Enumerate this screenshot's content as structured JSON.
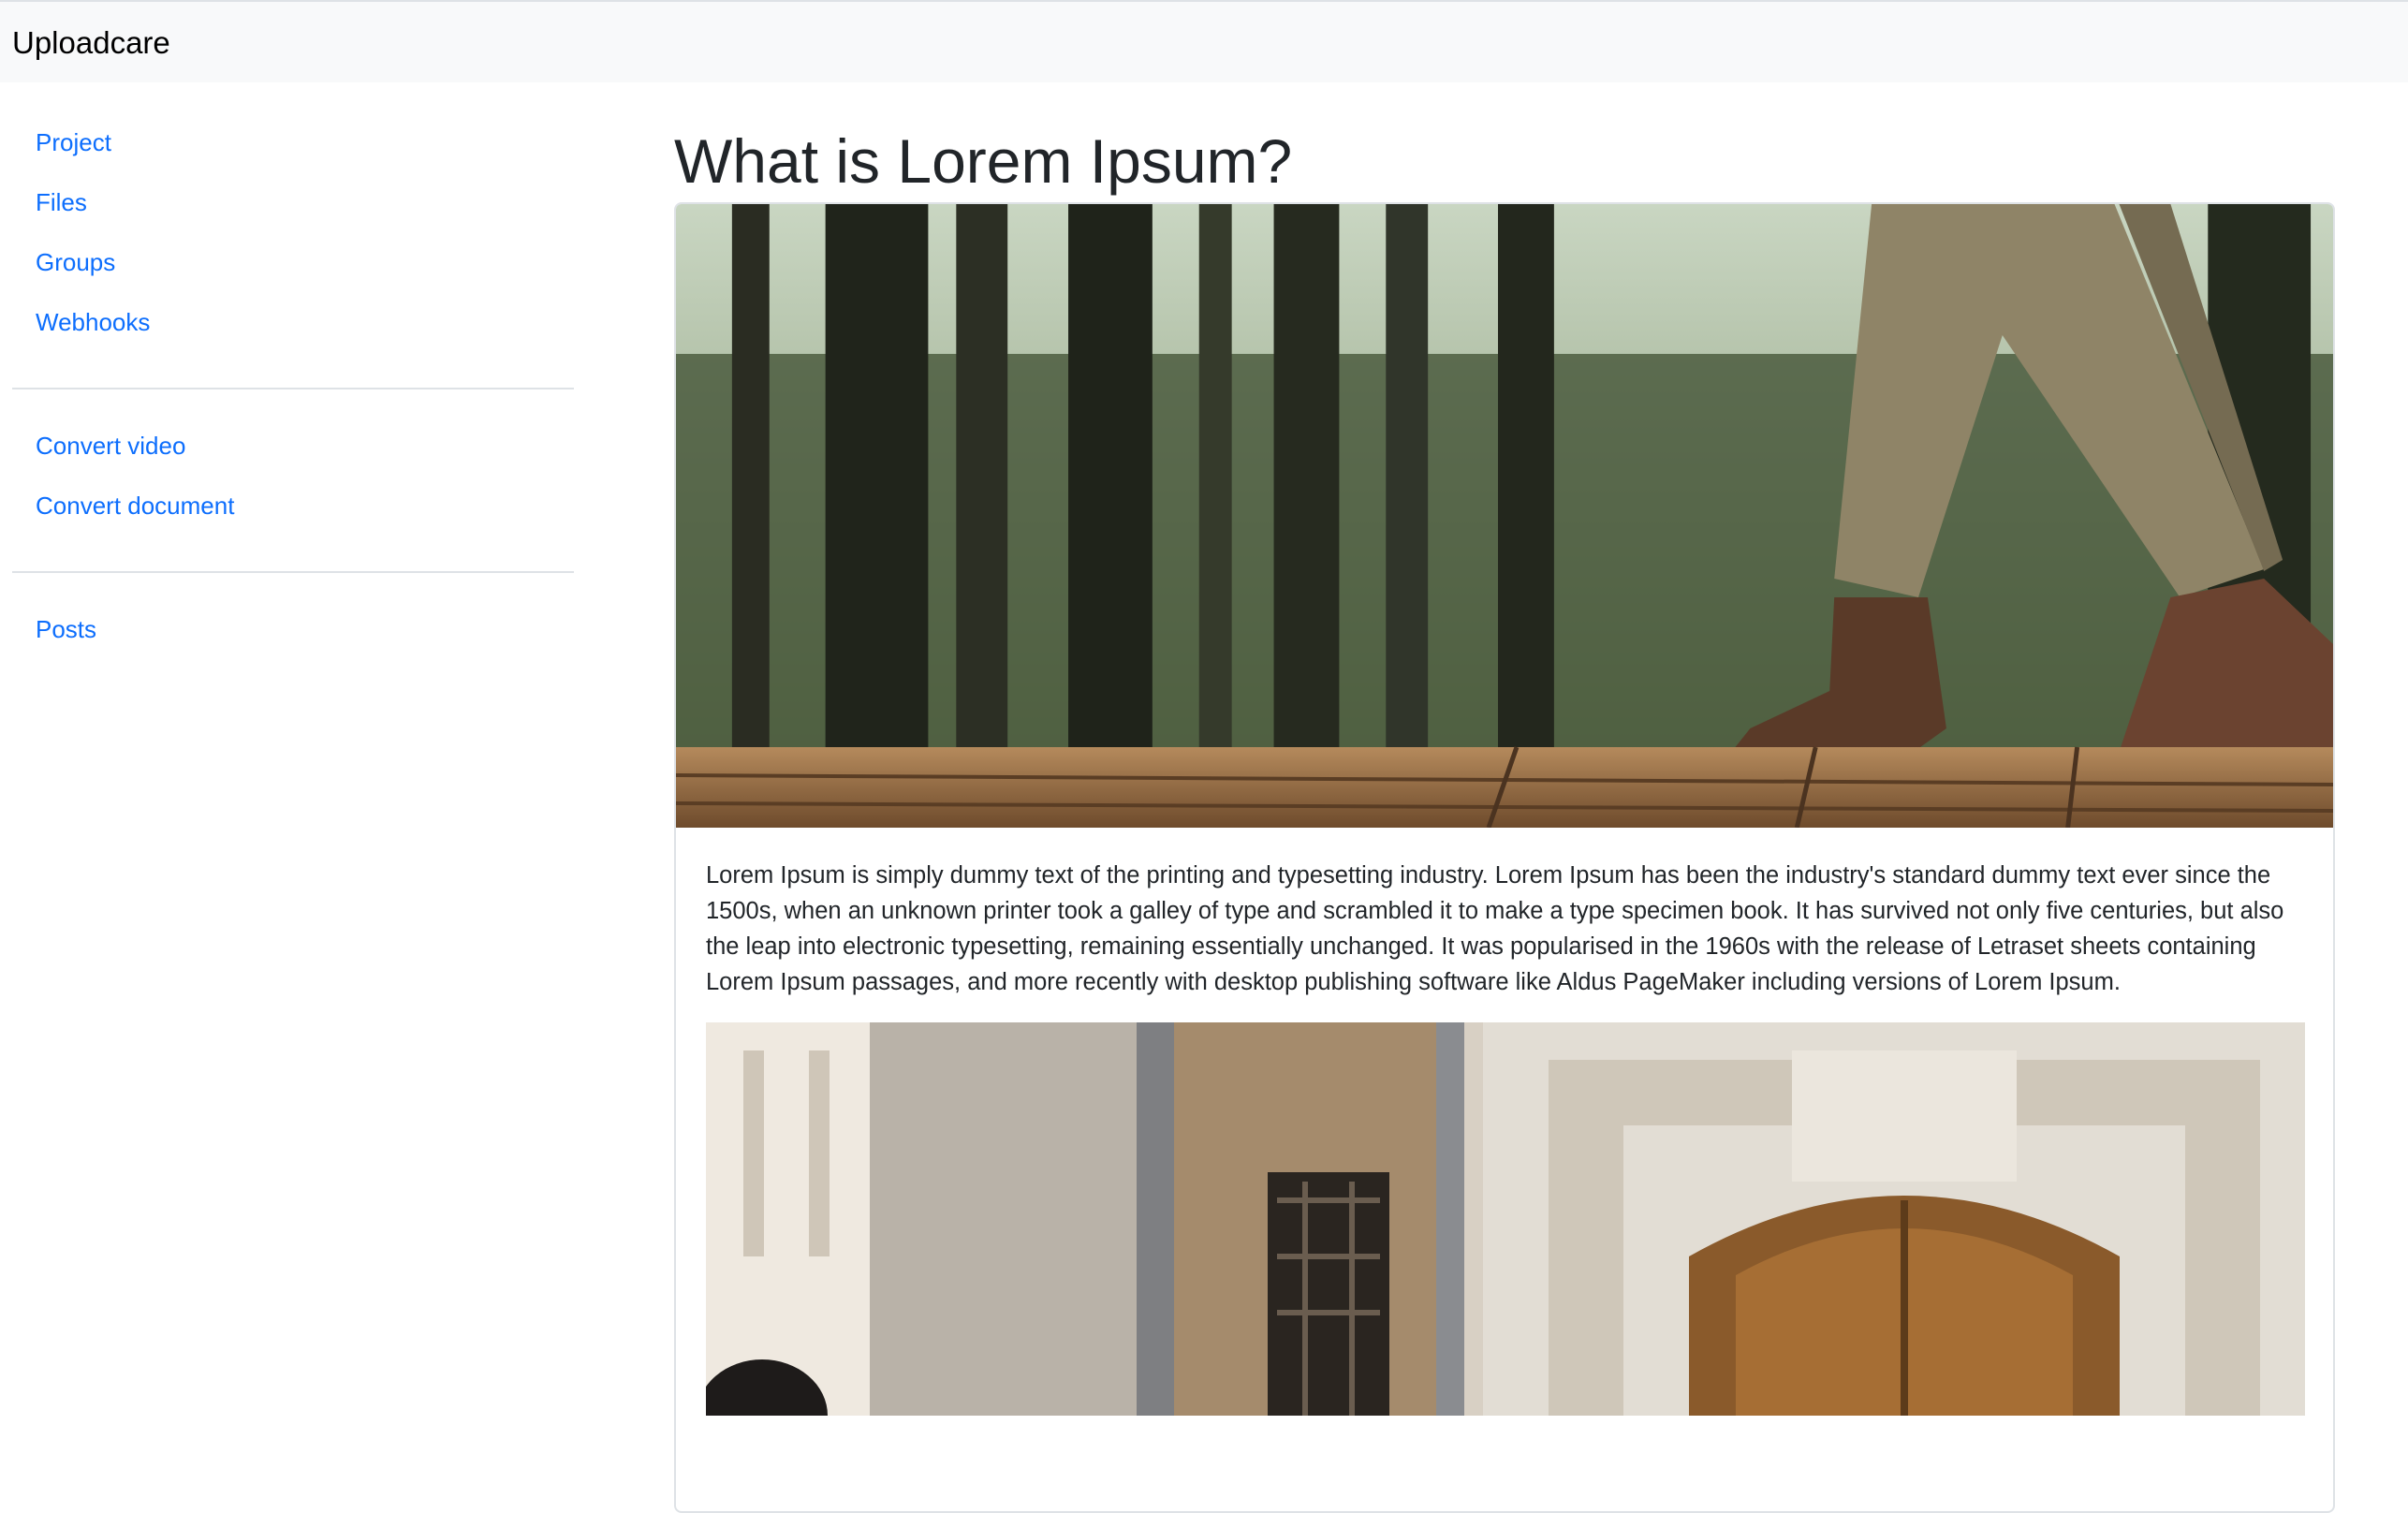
{
  "navbar": {
    "brand": "Uploadcare"
  },
  "sidebar": {
    "groups": [
      {
        "items": [
          "Project",
          "Files",
          "Groups",
          "Webhooks"
        ]
      },
      {
        "items": [
          "Convert video",
          "Convert document"
        ]
      },
      {
        "items": [
          "Posts"
        ]
      }
    ]
  },
  "post": {
    "title": "What is Lorem Ipsum?",
    "body": "Lorem Ipsum is simply dummy text of the printing and typesetting industry. Lorem Ipsum has been the industry's standard dummy text ever since the 1500s, when an unknown printer took a galley of type and scrambled it to make a type specimen book. It has survived not only five centuries, but also the leap into electronic typesetting, remaining essentially unchanged. It was popularised in the 1960s with the release of Letraset sheets containing Lorem Ipsum passages, and more recently with desktop publishing software like Aldus PageMaker including versions of Lorem Ipsum.",
    "hero_image": "hiker-boots-on-wooden-boardwalk-forest-photo",
    "second_image": "old-stone-building-wooden-door-photo"
  },
  "colors": {
    "link": "#0d6efd",
    "navbar_bg": "#f8f9fa",
    "border": "#dee2e6",
    "text": "#212529"
  }
}
